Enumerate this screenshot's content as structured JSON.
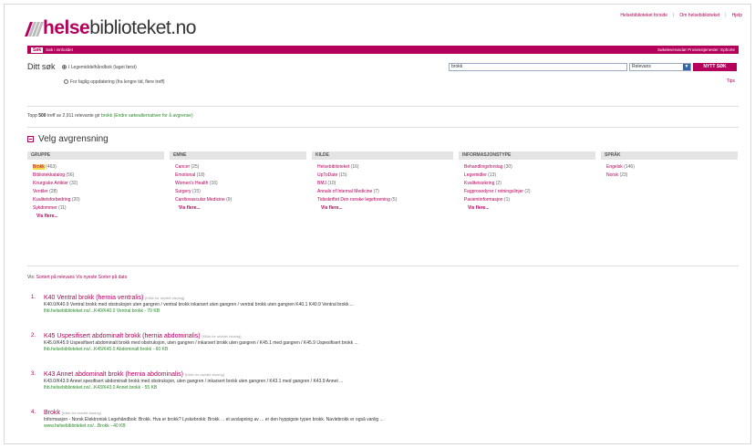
{
  "header": {
    "top_links": [
      "Helsebiblioteket forside",
      "Om helsebiblioteket",
      "Hjelp"
    ],
    "logo": {
      "brand_bold": "helse",
      "brand_rest": "biblioteket.no"
    }
  },
  "nav_bar": {
    "tag": "Søk",
    "label": "Søk i innholdet",
    "right_text": "Søkeleverandør Prosesstjenester: Ephorte"
  },
  "search": {
    "title": "Ditt søk",
    "option1": "I Legemiddelhåndbok (laget først)",
    "option2": "For faglig oppdatering (fra lengre tid, flere treff)",
    "query": "brokk",
    "select_value": "Relevans",
    "button_label": "NYTT SØK",
    "tips": "Tips"
  },
  "hits": {
    "prefix": "Topp",
    "count": "500",
    "middle": "treff av 2,911 relevante gir",
    "term": "brokk",
    "link": "(Endre søkealternativer for å avgrense)"
  },
  "narrow": {
    "label": "Velg avgrensning"
  },
  "facets": [
    {
      "header": "GRUPPE",
      "items": [
        {
          "label": "Brokk",
          "count": "(463)",
          "highlight": true
        },
        {
          "label": "Bibliotekkatalog",
          "count": "(56)"
        },
        {
          "label": "Kirurgiske Artikler",
          "count": "(32)"
        },
        {
          "label": "Ventiler",
          "count": "(28)"
        },
        {
          "label": "Kvalitetsforbedring",
          "count": "(20)"
        },
        {
          "label": "Sykdommer",
          "count": "(11)"
        }
      ],
      "more": "Vis flere..."
    },
    {
      "header": "EMNE",
      "items": [
        {
          "label": "Cancer",
          "count": "(25)"
        },
        {
          "label": "Emotional",
          "count": "(18)"
        },
        {
          "label": "Women's Health",
          "count": "(16)"
        },
        {
          "label": "Surgery",
          "count": "(15)"
        },
        {
          "label": "Cardiovascular Medicine",
          "count": "(9)"
        }
      ],
      "more": "Vis flere..."
    },
    {
      "header": "KILDE",
      "items": [
        {
          "label": "Helsebiblioteket",
          "count": "(16)"
        },
        {
          "label": "UpToDate",
          "count": "(15)"
        },
        {
          "label": "BMJ",
          "count": "(10)"
        },
        {
          "label": "Annals of Internal Medicine",
          "count": "(7)"
        },
        {
          "label": "Tidsskriftet Den norske legeforening",
          "count": "(5)"
        }
      ],
      "more": "Vis flere..."
    },
    {
      "header": "INFORMASJONSTYPE",
      "items": [
        {
          "label": "Behandlingsforslag",
          "count": "(30)"
        },
        {
          "label": "Legemidler",
          "count": "(13)"
        },
        {
          "label": "Kvalitetssikring",
          "count": "(2)"
        },
        {
          "label": "Fagprosedyrer / retningslinjer",
          "count": "(2)"
        },
        {
          "label": "Pasientinformasjon",
          "count": "(1)"
        }
      ],
      "more": "Vis flere..."
    },
    {
      "header": "SPRÅK",
      "items": [
        {
          "label": "Engelsk",
          "count": "(146)"
        },
        {
          "label": "Norsk",
          "count": "(23)"
        }
      ],
      "more": ""
    }
  ],
  "sort_line": {
    "prefix": "Vis:",
    "links": "Sortert på relevans",
    "mid": "Vis nyeste",
    "end": "Sorter på dato"
  },
  "results": [
    {
      "num": "1.",
      "title": "K40 Ventral brokk (hernia ventralis)",
      "tag": "[Klikk for utvidet visning]",
      "snippet": "K40.0/K40.9 Ventral brokk med obstruksjon uten gangren / ventral brokk inkarsert uten gangren / ventral brokk uten gangren K40.1 K40.9 Ventral brokk ...",
      "url": "lhb.helsebiblioteket.no/...K40/K40.0 Ventral brokk - 70 KB"
    },
    {
      "num": "2.",
      "title": "K45 Uspesifisert abdominalt brokk (hernia abdominalis)",
      "tag": "[Klikk for utvidet visning]",
      "snippet": "K45.0/K45.9 Uspesifisert abdominalt brokk med obstruksjon, uten gangren / inkarsert brokk uten gangren / K45.1 med gangren / K45.9 Uspesifisert brokk ...",
      "url": "lhb.helsebiblioteket.no/...K45/K45.0 Abdominalt brokk - 60 KB"
    },
    {
      "num": "3.",
      "title": "K43 Annet abdominalt brokk (hernia abdominalis)",
      "tag": "[Klikk for utvidet visning]",
      "snippet": "K43.0/K43.9 Annet spesifisert abdominalt brokk med obstruksjon, uten gangren / inkarsert brokk uten gangren / K43.1 med gangren / K43.9 Annet ...",
      "url": "lhb.helsebiblioteket.no/...K43/K43.0 Annet brokk - 55 KB"
    },
    {
      "num": "4.",
      "title": "Brokk",
      "tag": "[Klikk for utvidet visning]",
      "snippet": "Informasjon - Norsk Elektronisk Legehåndbok: Brokk. Hva er brokk? Lyskebrokk: Brokk ... et avslapning av ... er den hyppigste typen brokk. Navlebrokk er også vanlig ...",
      "url": "www.helsebiblioteket.no/...Brokk - 40 KB"
    }
  ],
  "colors": {
    "brand": "#b5005b",
    "url_green": "#2a8a2a",
    "highlight": "#f6d94a"
  }
}
